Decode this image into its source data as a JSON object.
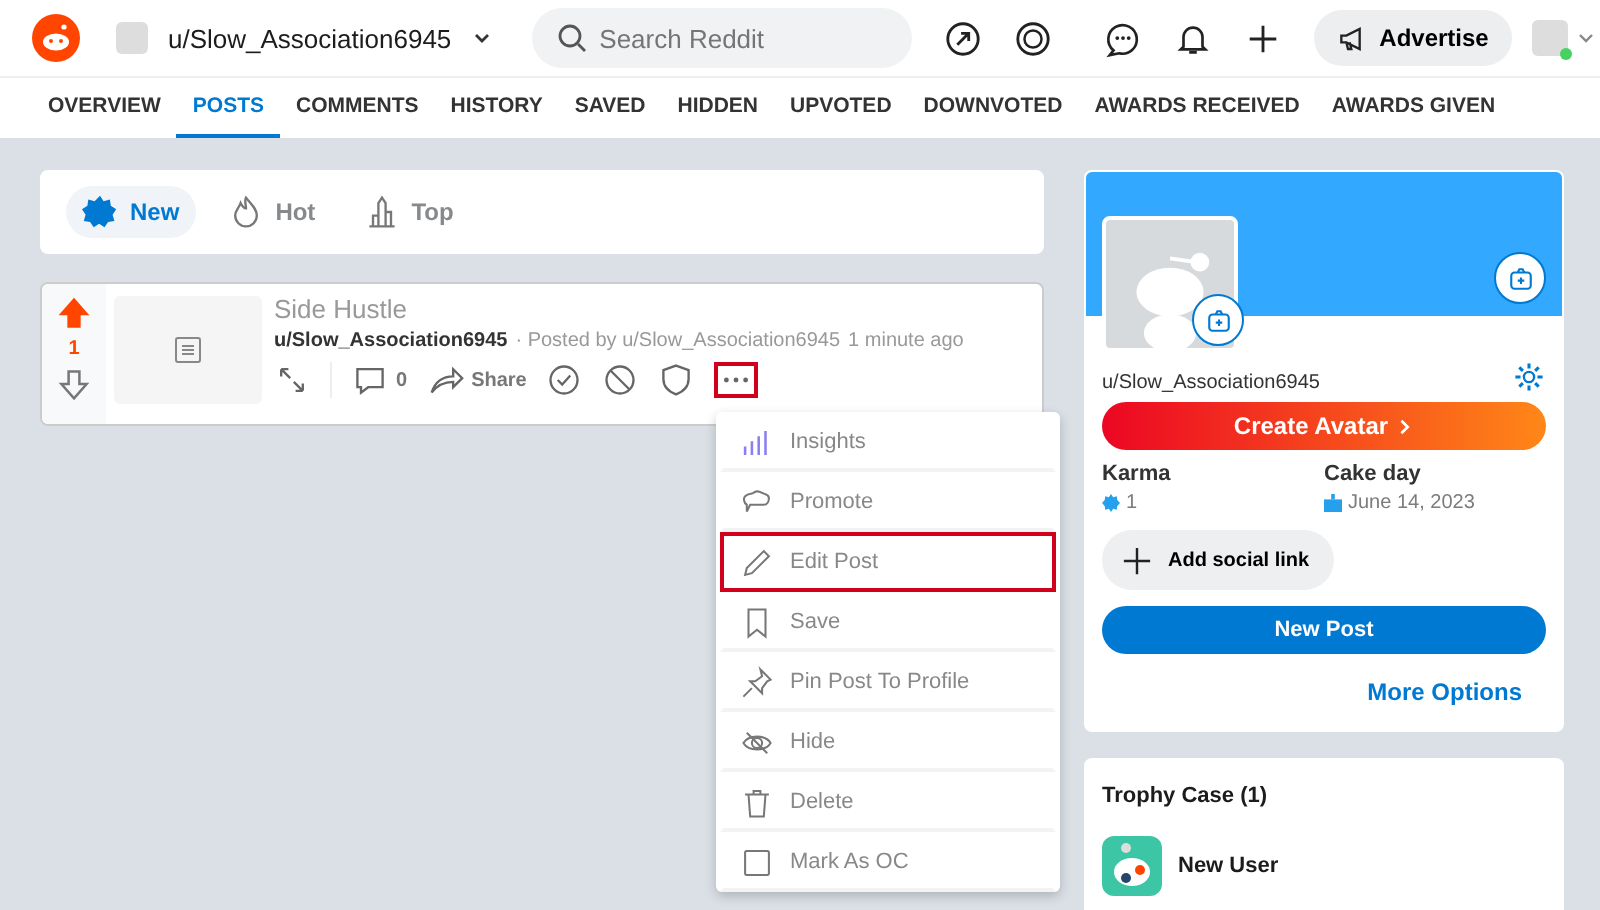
{
  "header": {
    "community": "u/Slow_Association6945",
    "search": {
      "placeholder": "Search Reddit"
    },
    "advertise": "Advertise"
  },
  "nav_tabs": [
    {
      "label": "OVERVIEW",
      "selected": false
    },
    {
      "label": "POSTS",
      "selected": true
    },
    {
      "label": "COMMENTS",
      "selected": false
    },
    {
      "label": "HISTORY",
      "selected": false
    },
    {
      "label": "SAVED",
      "selected": false
    },
    {
      "label": "HIDDEN",
      "selected": false
    },
    {
      "label": "UPVOTED",
      "selected": false
    },
    {
      "label": "DOWNVOTED",
      "selected": false
    },
    {
      "label": "AWARDS RECEIVED",
      "selected": false
    },
    {
      "label": "AWARDS GIVEN",
      "selected": false
    }
  ],
  "sort_options": [
    {
      "label": "New",
      "selected": true
    },
    {
      "label": "Hot",
      "selected": false
    },
    {
      "label": "Top",
      "selected": false
    }
  ],
  "post": {
    "votes": "1",
    "upvoted": true,
    "title": "Side Hustle",
    "author": "u/Slow_Association6945",
    "posted_by": "· Posted by u/Slow_Association6945",
    "time": "1 minute ago",
    "comments": "0",
    "share": "Share",
    "more_highlighted": true
  },
  "menu": [
    {
      "label": "Insights",
      "highlighted": false
    },
    {
      "label": "Promote",
      "highlighted": false
    },
    {
      "label": "Edit Post",
      "highlighted": true
    },
    {
      "label": "Save",
      "highlighted": false
    },
    {
      "label": "Pin Post To Profile",
      "highlighted": false
    },
    {
      "label": "Hide",
      "highlighted": false
    },
    {
      "label": "Delete",
      "highlighted": false
    },
    {
      "label": "Mark As OC",
      "highlighted": false
    }
  ],
  "profile": {
    "username": "u/Slow_Association6945",
    "create_avatar": "Create Avatar",
    "karma_label": "Karma",
    "karma": "1",
    "cakeday_label": "Cake day",
    "cakeday": "June 14, 2023",
    "add_social": "Add social link",
    "new_post": "New Post",
    "more_options": "More Options"
  },
  "trophy_case": {
    "title": "Trophy Case (1)",
    "items": [
      {
        "name": "New User"
      }
    ]
  }
}
